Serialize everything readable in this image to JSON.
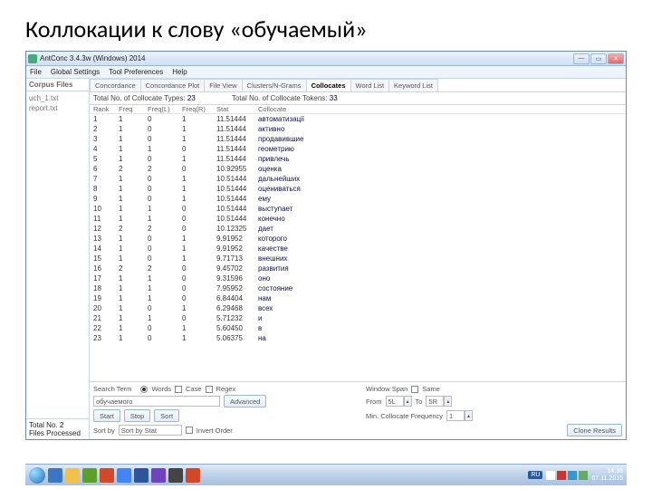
{
  "slide_title": "Коллокации к слову «обучаемый»",
  "window_title": "AntConc 3.4.3w (Windows) 2014",
  "menubar": [
    "File",
    "Global Settings",
    "Tool Preferences",
    "Help"
  ],
  "sidebar": {
    "header": "Corpus Files",
    "files": [
      "uch_1.txt",
      "report.txt"
    ],
    "total_label": "Total No.",
    "total_value": "2",
    "files_processed_label": "Files Processed"
  },
  "tabs": [
    "Concordance",
    "Concordance Plot",
    "File View",
    "Clusters/N-Grams",
    "Collocates",
    "Word List",
    "Keyword List"
  ],
  "active_tab": 4,
  "stats": {
    "types_label": "Total No. of Collocate Types:",
    "types_value": "23",
    "tokens_label": "Total No. of Collocate Tokens:",
    "tokens_value": "33"
  },
  "columns": [
    "Rank",
    "Freq",
    "Freq(L)",
    "Freq(R)",
    "Stat",
    "Collocate"
  ],
  "rows": [
    [
      "1",
      "1",
      "0",
      "1",
      "11.51444",
      "автоматизації"
    ],
    [
      "2",
      "1",
      "0",
      "1",
      "11.51444",
      "активно"
    ],
    [
      "3",
      "1",
      "0",
      "1",
      "11.51444",
      "продавившие"
    ],
    [
      "4",
      "1",
      "1",
      "0",
      "11.51444",
      "геометрию"
    ],
    [
      "5",
      "1",
      "0",
      "1",
      "11.51444",
      "привлечь"
    ],
    [
      "6",
      "2",
      "2",
      "0",
      "10.92955",
      "оценка"
    ],
    [
      "7",
      "1",
      "0",
      "1",
      "10.51444",
      "дальнейших"
    ],
    [
      "8",
      "1",
      "0",
      "1",
      "10.51444",
      "оцениваться"
    ],
    [
      "9",
      "1",
      "0",
      "1",
      "10.51444",
      "ему"
    ],
    [
      "10",
      "1",
      "1",
      "0",
      "10.51444",
      "выступает"
    ],
    [
      "11",
      "1",
      "1",
      "0",
      "10.51444",
      "конечно"
    ],
    [
      "12",
      "2",
      "2",
      "0",
      "10.12325",
      "дает"
    ],
    [
      "13",
      "1",
      "0",
      "1",
      "9.91952",
      "которого"
    ],
    [
      "14",
      "1",
      "0",
      "1",
      "9.91952",
      "качестве"
    ],
    [
      "15",
      "1",
      "0",
      "1",
      "9.71713",
      "внешних"
    ],
    [
      "16",
      "2",
      "2",
      "0",
      "9.45702",
      "развития"
    ],
    [
      "17",
      "1",
      "1",
      "0",
      "9.31596",
      "оно"
    ],
    [
      "18",
      "1",
      "1",
      "0",
      "7.95952",
      "состояние"
    ],
    [
      "19",
      "1",
      "1",
      "0",
      "6.84404",
      "нам"
    ],
    [
      "20",
      "1",
      "0",
      "1",
      "6.29468",
      "всех"
    ],
    [
      "21",
      "1",
      "1",
      "0",
      "5.71232",
      "и"
    ],
    [
      "22",
      "1",
      "0",
      "1",
      "5.60450",
      "в"
    ],
    [
      "23",
      "1",
      "0",
      "1",
      "5.06375",
      "на"
    ]
  ],
  "controls": {
    "search_label": "Search Term",
    "words_label": "Words",
    "case_label": "Case",
    "regex_label": "Regex",
    "search_value": "обучаемого",
    "start_btn": "Start",
    "stop_btn": "Stop",
    "sort_btn": "Sort",
    "sort_by_label": "Sort by",
    "sort_by_value": "Sort by Stat",
    "invert_label": "Invert Order",
    "win_span_label": "Window Span",
    "same_label": "Same",
    "from_label": "From",
    "from_value": "5L",
    "to_label": "To",
    "to_value": "5R",
    "min_freq_label": "Min. Collocate Frequency",
    "min_freq_value": "1",
    "adv_btn": "Advanced",
    "clone_btn": "Clone Results"
  },
  "taskbar": {
    "lang": "RU",
    "time": "14:36",
    "date": "07.11.2015"
  }
}
